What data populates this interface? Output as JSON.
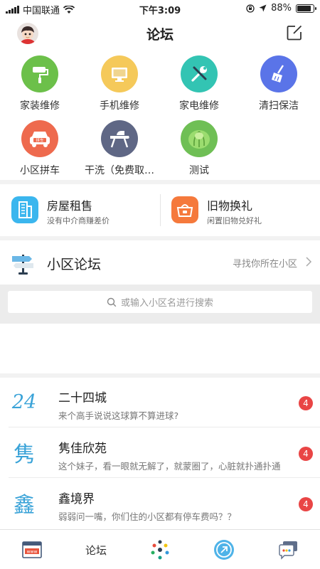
{
  "status": {
    "carrier": "中国联通",
    "time": "下午3:09",
    "battery": "88%"
  },
  "header": {
    "title": "论坛",
    "avatar_icon": "avatar",
    "edit_icon": "edit-icon"
  },
  "services": [
    {
      "label": "家装维修",
      "icon": "paint-roller-icon",
      "color": "#6cc04a"
    },
    {
      "label": "手机维修",
      "icon": "monitor-icon",
      "color": "#f5c95a"
    },
    {
      "label": "家电维修",
      "icon": "wrench-screwdriver-icon",
      "color": "#33c4b3"
    },
    {
      "label": "清扫保洁",
      "icon": "broom-icon",
      "color": "#5a74e8"
    },
    {
      "label": "小区拼车",
      "icon": "carpool-icon",
      "color": "#ee6a4e"
    },
    {
      "label": "干洗（免费取…",
      "icon": "ironing-board-icon",
      "color": "#5f6785"
    },
    {
      "label": "测试",
      "icon": "cabbage-icon",
      "color": "#6fbf55"
    }
  ],
  "promos": [
    {
      "title": "房屋租售",
      "subtitle": "没有中介商赚差价",
      "icon": "building-icon",
      "color": "#3bb6ee"
    },
    {
      "title": "旧物换礼",
      "subtitle": "闲置旧物兑好礼",
      "icon": "basket-icon",
      "color": "#f5793c"
    }
  ],
  "forum": {
    "title": "小区论坛",
    "find_label": "寻找你所在小区",
    "search_placeholder": "或输入小区名进行搜索"
  },
  "communities": [
    {
      "logo": "24",
      "name": "二十四城",
      "desc": "来个高手说说这球算不算进球?",
      "badge": "4"
    },
    {
      "logo": "隽",
      "name": "隽佳欣苑",
      "desc": "这个妹子，看一眼就无解了，就蒙圈了，心脏就扑通扑通",
      "badge": "4"
    },
    {
      "logo": "鑫",
      "name": "鑫境界",
      "desc": "弱弱问一嘴，你们住的小区都有停车费吗？？",
      "badge": "4"
    }
  ],
  "tabbar": {
    "tab2_label": "论坛"
  }
}
